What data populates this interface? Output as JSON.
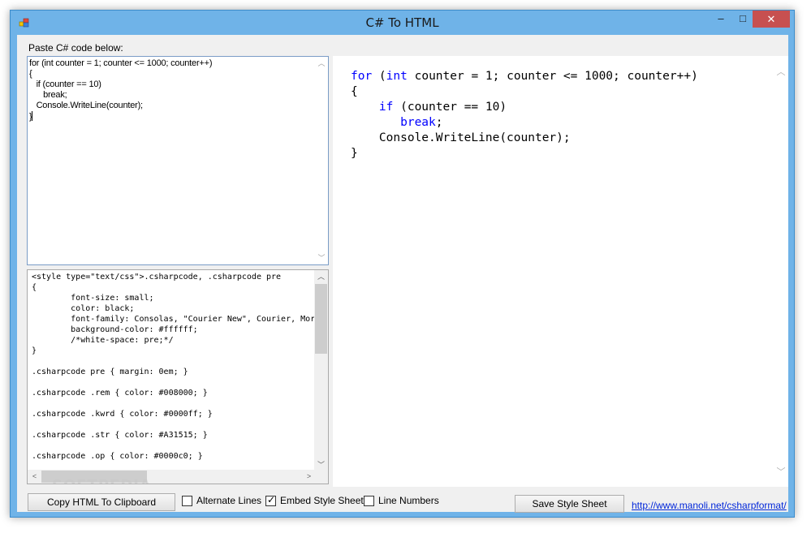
{
  "window": {
    "title": "C# To HTML",
    "controls": {
      "minimize": "–",
      "maximize": "□",
      "close": "✕"
    }
  },
  "labels": {
    "paste": "Paste C# code below:"
  },
  "watermark": "SOFTPEDIA",
  "input_code": "for (int counter = 1; counter <= 1000; counter++)\n{\n   if (counter == 10)\n      break;\n   Console.WriteLine(counter);\n}",
  "css_output": "<style type=\"text/css\">.csharpcode, .csharpcode pre\n{\n        font-size: small;\n        color: black;\n        font-family: Consolas, \"Courier New\", Courier, Mor\n        background-color: #ffffff;\n        /*white-space: pre;*/\n}\n\n.csharpcode pre { margin: 0em; }\n\n.csharpcode .rem { color: #008000; }\n\n.csharpcode .kwrd { color: #0000ff; }\n\n.csharpcode .str { color: #A31515; }\n\n.csharpcode .op { color: #0000c0; }",
  "preview": {
    "line1": {
      "kw_for": "for",
      "p1": " (",
      "kw_int": "int",
      "p2": " counter = 1; counter <= 1000; counter++)"
    },
    "line2": "{",
    "line3": {
      "indent": "    ",
      "kw_if": "if",
      "rest": " (counter == 10)"
    },
    "line4": {
      "indent": "       ",
      "kw_break": "break",
      "rest": ";"
    },
    "line5": "    Console.WriteLine(counter);",
    "line6": "}"
  },
  "buttons": {
    "copy": "Copy HTML To Clipboard",
    "save": "Save Style Sheet"
  },
  "checkboxes": {
    "alternate": {
      "label": "Alternate Lines",
      "checked": false
    },
    "embed": {
      "label": "Embed Style Sheet",
      "checked": true
    },
    "line_numbers": {
      "label": "Line Numbers",
      "checked": false
    }
  },
  "link": "http://www.manoli.net/csharpformat/",
  "colors": {
    "keyword": "#0000ff",
    "frame": "#6fb3e8",
    "close": "#c75050",
    "link": "#0026d9"
  }
}
